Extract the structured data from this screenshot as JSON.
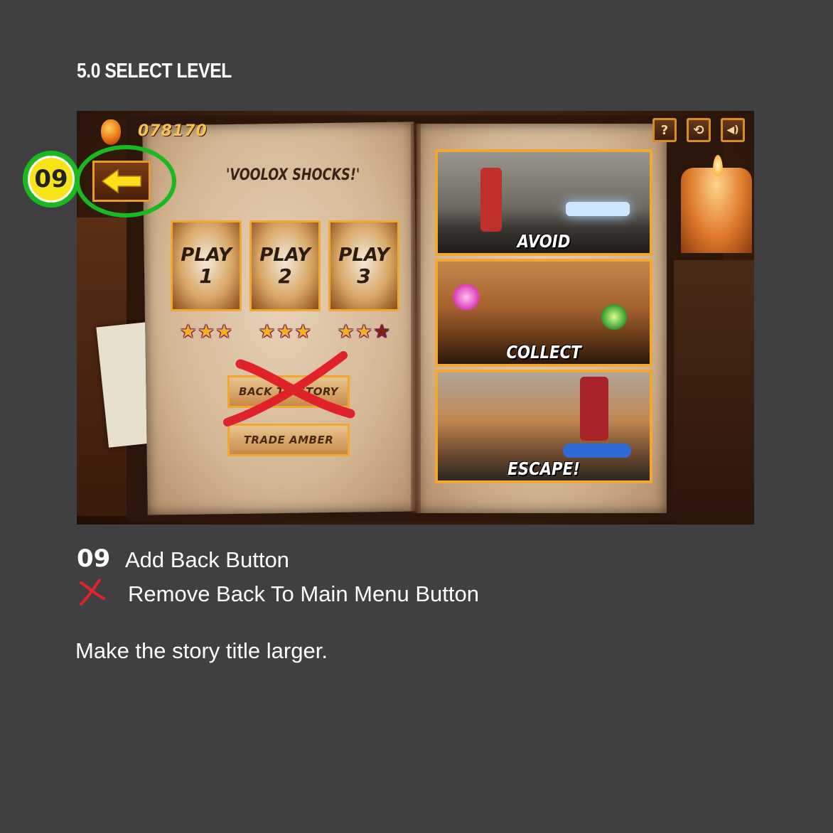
{
  "section": {
    "title": "5.0  SELECT LEVEL"
  },
  "game": {
    "score": "078170",
    "top_buttons": [
      "?",
      "⟲",
      "◀)"
    ],
    "story_title": "'VOOLOX SHOCKS!'",
    "levels": [
      {
        "label": "PLAY",
        "number": "1",
        "stars_earned": 3,
        "stars_total": 3
      },
      {
        "label": "PLAY",
        "number": "2",
        "stars_earned": 3,
        "stars_total": 3
      },
      {
        "label": "PLAY",
        "number": "3",
        "stars_earned": 2,
        "stars_total": 3
      }
    ],
    "menu_buttons": {
      "back_to_story": "BACK TO STORY",
      "trade_amber": "TRADE AMBER"
    },
    "panels": [
      "AVOID",
      "COLLECT",
      "ESCAPE!"
    ]
  },
  "annotation": {
    "badge": "09",
    "color": "#19b91f",
    "cross_color": "#e0232b"
  },
  "notes": {
    "item1_number": "09",
    "item1_text": "Add Back Button",
    "item2_text": "Remove Back To Main Menu Button",
    "paragraph": "Make the story title larger."
  }
}
